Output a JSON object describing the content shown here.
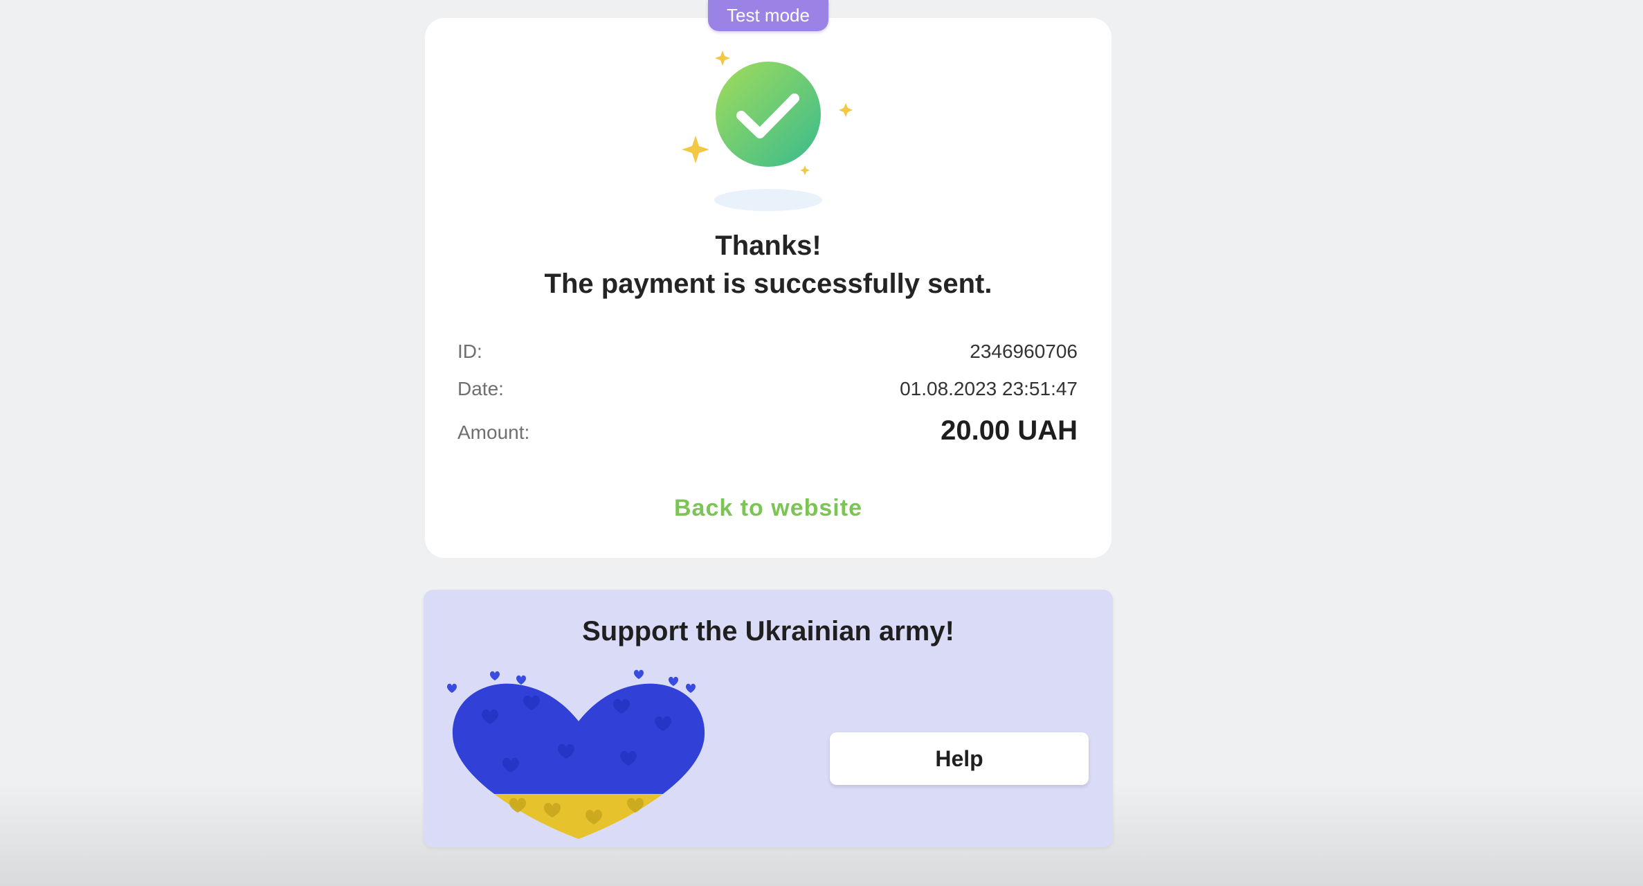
{
  "badge": {
    "label": "Test mode"
  },
  "receipt": {
    "title_line1": "Thanks!",
    "title_line2": "The payment is successfully sent.",
    "rows": [
      {
        "label": "ID:",
        "value": "2346960706"
      },
      {
        "label": "Date:",
        "value": "01.08.2023 23:51:47"
      },
      {
        "label": "Amount:",
        "value": "20.00 UAH"
      }
    ],
    "back_link": "Back to website"
  },
  "support": {
    "title": "Support the Ukrainian army!",
    "help_button": "Help"
  },
  "icons": {
    "success": "check-circle-icon",
    "heart": "ukraine-heart-illustration"
  },
  "colors": {
    "badge": "#9b83e6",
    "success_gradient_start": "#9ad95e",
    "success_gradient_end": "#3fbf86",
    "sparkle": "#f2c744",
    "link": "#7cc456",
    "support_bg": "#dadcf7",
    "heart_blue": "#2d3fd8",
    "heart_yellow": "#e8c52c"
  }
}
